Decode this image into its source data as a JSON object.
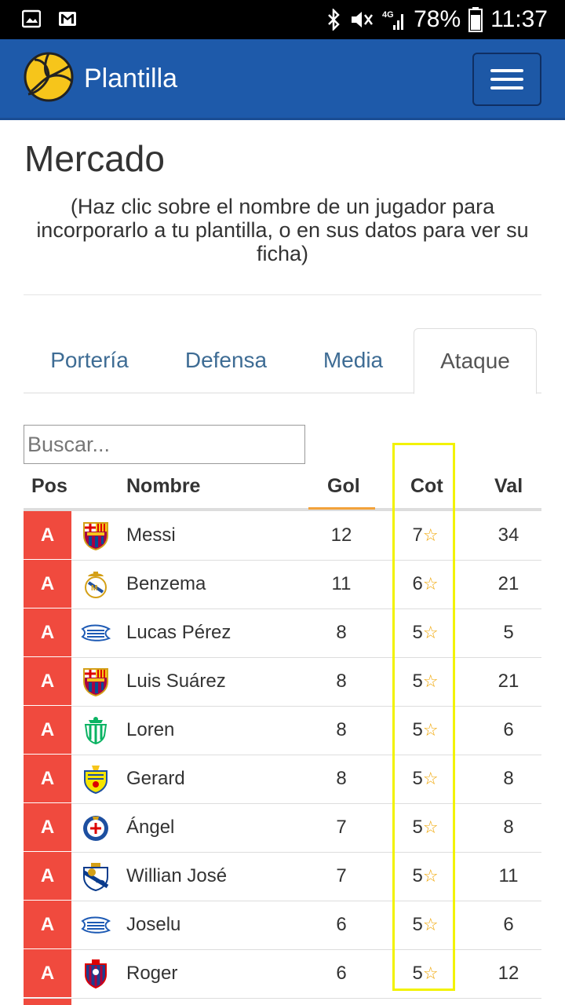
{
  "status_bar": {
    "battery": "78%",
    "time": "11:37",
    "network": "4G"
  },
  "navbar": {
    "brand": "Plantilla"
  },
  "page": {
    "title": "Mercado",
    "subtitle": "(Haz clic sobre el nombre de un jugador para incorporarlo a tu plantilla, o en sus datos para ver su ficha)"
  },
  "tabs": [
    {
      "label": "Portería",
      "active": false
    },
    {
      "label": "Defensa",
      "active": false
    },
    {
      "label": "Media",
      "active": false
    },
    {
      "label": "Ataque",
      "active": true
    }
  ],
  "search": {
    "placeholder": "Buscar...",
    "value": ""
  },
  "table": {
    "headers": {
      "pos": "Pos",
      "name": "Nombre",
      "gol": "Gol",
      "cot": "Cot",
      "val": "Val"
    },
    "sorted_by": "Gol",
    "rows": [
      {
        "pos": "A",
        "team_crest": "barcelona-crest",
        "name": "Messi",
        "gol": "12",
        "cot": "7",
        "val": "34"
      },
      {
        "pos": "A",
        "team_crest": "real-madrid-crest",
        "name": "Benzema",
        "gol": "11",
        "cot": "6",
        "val": "21"
      },
      {
        "pos": "A",
        "team_crest": "alaves-crest",
        "name": "Lucas Pérez",
        "gol": "8",
        "cot": "5",
        "val": "5"
      },
      {
        "pos": "A",
        "team_crest": "barcelona-crest",
        "name": "Luis Suárez",
        "gol": "8",
        "cot": "5",
        "val": "21"
      },
      {
        "pos": "A",
        "team_crest": "betis-crest",
        "name": "Loren",
        "gol": "8",
        "cot": "5",
        "val": "6"
      },
      {
        "pos": "A",
        "team_crest": "villarreal-crest",
        "name": "Gerard",
        "gol": "8",
        "cot": "5",
        "val": "8"
      },
      {
        "pos": "A",
        "team_crest": "getafe-crest",
        "name": "Ángel",
        "gol": "7",
        "cot": "5",
        "val": "8"
      },
      {
        "pos": "A",
        "team_crest": "real-sociedad-crest",
        "name": "Willian José",
        "gol": "7",
        "cot": "5",
        "val": "11"
      },
      {
        "pos": "A",
        "team_crest": "alaves-crest",
        "name": "Joselu",
        "gol": "6",
        "cot": "5",
        "val": "6"
      },
      {
        "pos": "A",
        "team_crest": "levante-crest",
        "name": "Roger",
        "gol": "6",
        "cot": "5",
        "val": "12"
      }
    ]
  },
  "colors": {
    "navbar": "#1e5aaa",
    "position_badge": "#f04a3e",
    "star": "#f0a500",
    "highlight_box": "#f2f200"
  }
}
